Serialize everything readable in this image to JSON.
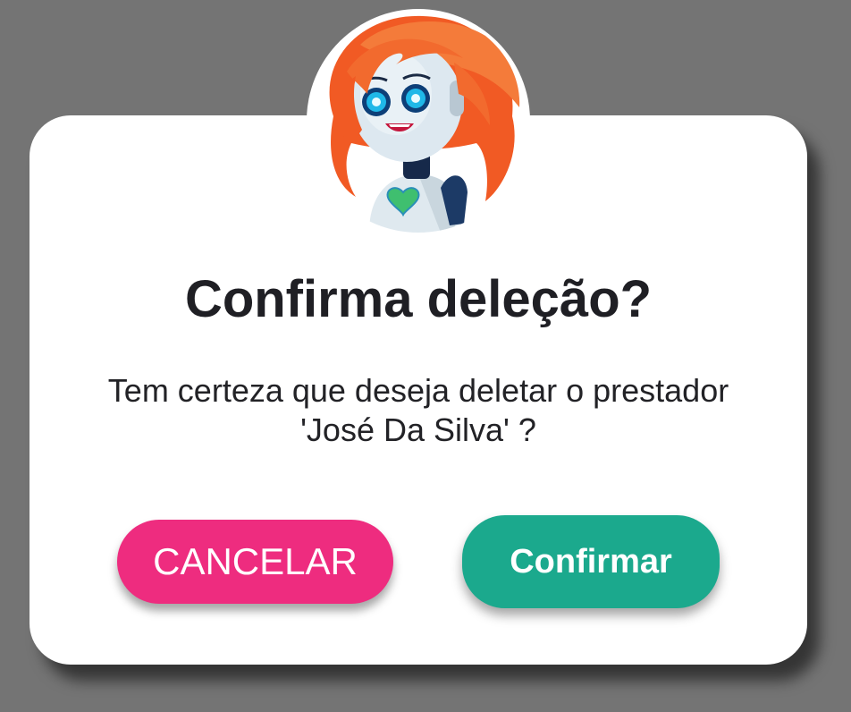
{
  "dialog": {
    "title": "Confirma deleção?",
    "message_line1": "Tem certeza que deseja deletar o prestador",
    "message_line2": "'José Da Silva' ?",
    "cancel_label": "CANCELAR",
    "confirm_label": "Confirmar"
  },
  "avatar": {
    "icon": "robot-mascot-avatar"
  },
  "colors": {
    "backdrop": "#747474",
    "dialog_bg": "#ffffff",
    "cancel": "#ee2c7f",
    "confirm": "#1ba98d",
    "mascot_hair": "#f26a2e",
    "mascot_eyes": "#1fb8e8"
  }
}
